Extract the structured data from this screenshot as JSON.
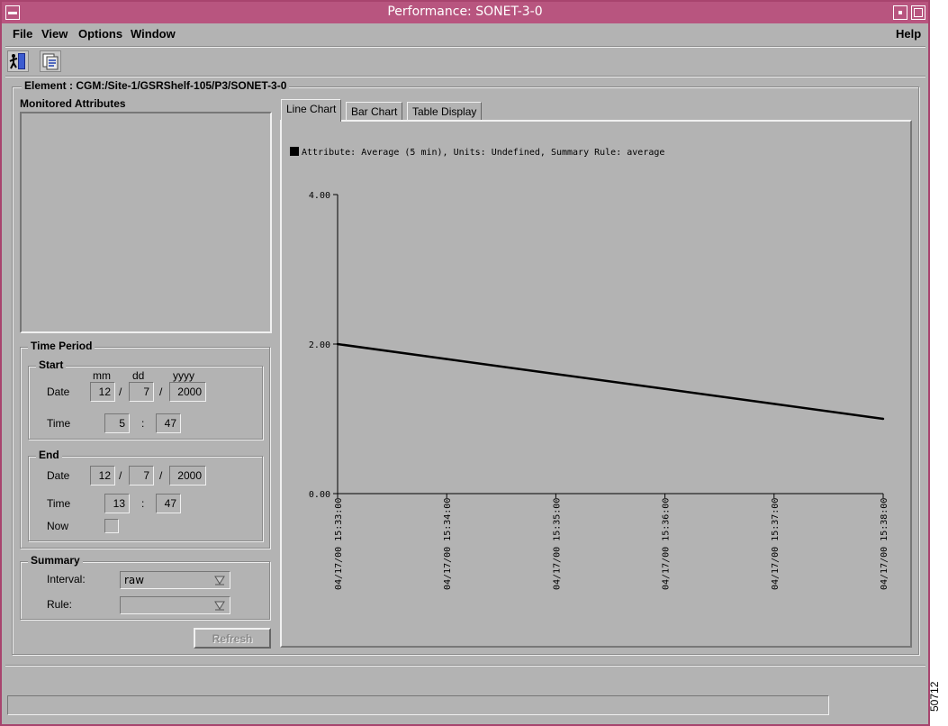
{
  "window": {
    "title": "Performance: SONET-3-0"
  },
  "menu": {
    "file": "File",
    "view": "View",
    "options": "Options",
    "window": "Window",
    "help": "Help"
  },
  "toolbar": {
    "exit_icon": "exit-door-icon",
    "refresh_icon": "refresh-icon"
  },
  "element": {
    "label": "Element : CGM:/Site-1/GSRShelf-105/P3/SONET-3-0"
  },
  "monitored": {
    "title": "Monitored Attributes"
  },
  "time_period": {
    "title": "Time Period",
    "start": {
      "title": "Start",
      "mm_label": "mm",
      "dd_label": "dd",
      "yyyy_label": "yyyy",
      "date_label": "Date",
      "time_label": "Time",
      "month": "12",
      "day": "7",
      "year": "2000",
      "hour": "5",
      "minute": "47",
      "sep_slash": "/",
      "sep_colon": ":"
    },
    "end": {
      "title": "End",
      "date_label": "Date",
      "time_label": "Time",
      "now_label": "Now",
      "month": "12",
      "day": "7",
      "year": "2000",
      "hour": "13",
      "minute": "47",
      "sep_slash": "/",
      "sep_colon": ":"
    }
  },
  "summary": {
    "title": "Summary",
    "interval_label": "Interval:",
    "interval_value": "raw",
    "rule_label": "Rule:",
    "rule_value": ""
  },
  "refresh_button": "Refresh",
  "tabs": [
    "Line Chart",
    "Bar Chart",
    "Table Display"
  ],
  "chart_data": {
    "type": "line",
    "legend": "Attribute: Average (5 min), Units: Undefined, Summary Rule: average",
    "x": [
      "04/17/00 15:33:00",
      "04/17/00 15:34:00",
      "04/17/00 15:35:00",
      "04/17/00 15:36:00",
      "04/17/00 15:37:00",
      "04/17/00 15:38:00"
    ],
    "series": [
      {
        "values": [
          2.0,
          1.8,
          1.6,
          1.4,
          1.2,
          1.0
        ]
      }
    ],
    "ylim": [
      0,
      4
    ],
    "yticks": [
      "0.00",
      "2.00",
      "4.00"
    ],
    "line_color": "#000000",
    "legend_position": "top-left",
    "grid": false
  },
  "side_id": "50712"
}
